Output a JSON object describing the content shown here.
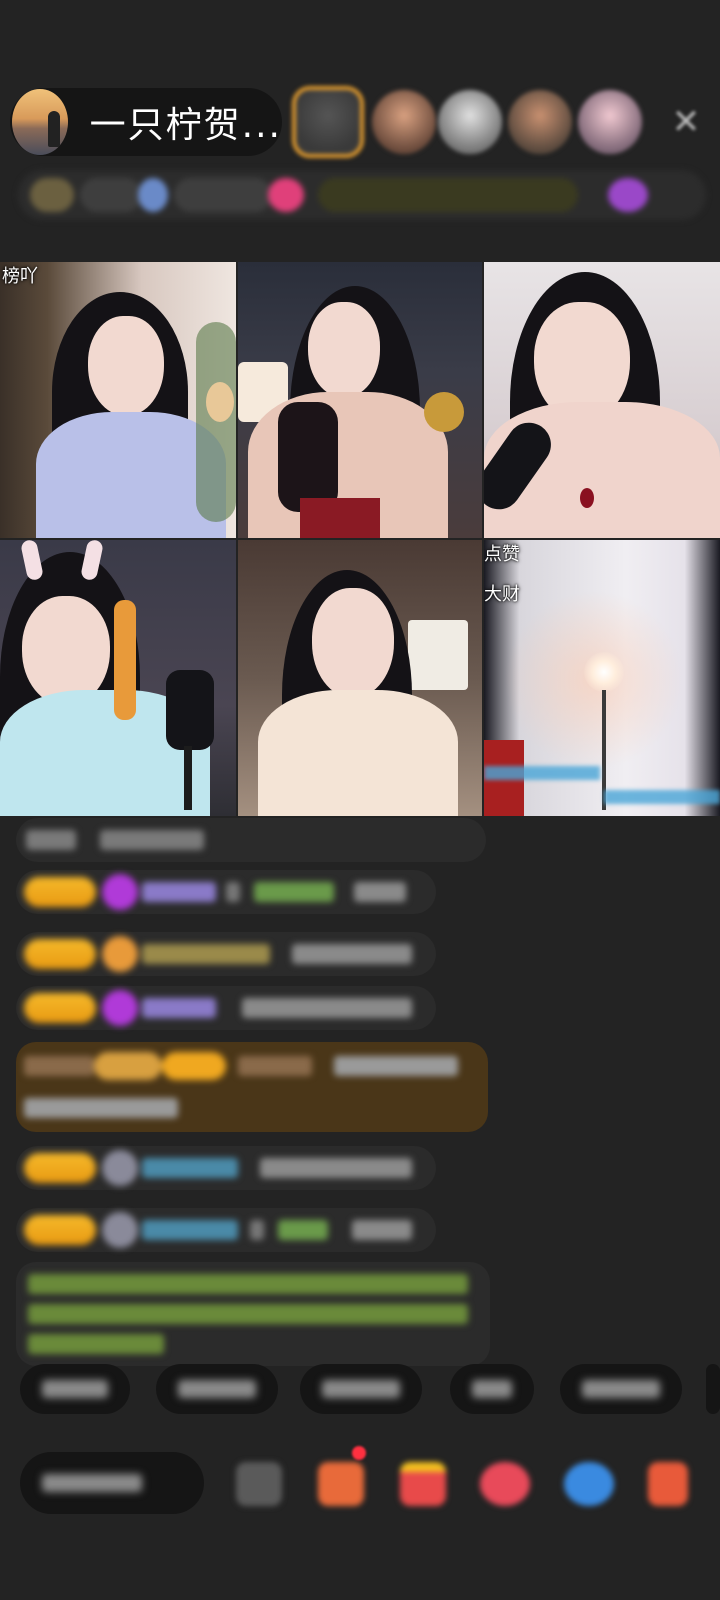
{
  "header": {
    "host_name": "一只柠贺...",
    "close_icon": "close-icon",
    "viewer_count": 5
  },
  "grid": {
    "tiles": [
      {
        "caption": "榜吖"
      },
      {
        "caption": ""
      },
      {
        "caption": ""
      },
      {
        "caption": ""
      },
      {
        "caption": ""
      },
      {
        "caption_top": "点赞",
        "caption_mid": "大财"
      }
    ]
  },
  "chat": {
    "messages_count": 9
  },
  "quick_replies": {
    "count": 6
  },
  "bottom_bar": {
    "icons": [
      "more-icon",
      "gift-box-icon",
      "treasure-icon",
      "heart-gift-icon",
      "share-icon",
      "gift-icon"
    ]
  }
}
